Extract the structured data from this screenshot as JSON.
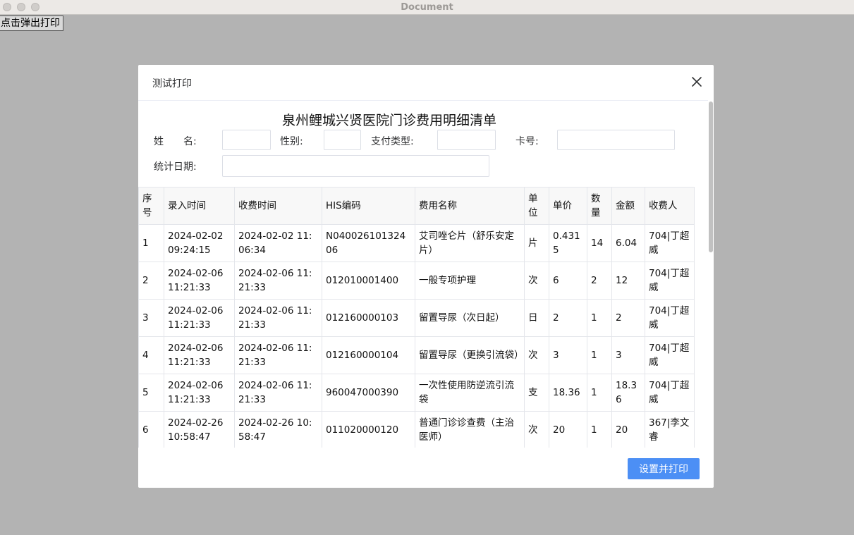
{
  "window": {
    "title": "Document"
  },
  "page": {
    "open_button": "点击弹出打印"
  },
  "dialog": {
    "title": "测试打印",
    "doc_title": "泉州鲤城兴贤医院门诊费用明细清单",
    "labels": {
      "name": "姓　　名:",
      "gender": "性别:",
      "pay_type": "支付类型:",
      "card_no": "卡号:",
      "stat_date": "统计日期:"
    },
    "fields": {
      "name": "",
      "gender": "",
      "pay_type": "",
      "card_no": "",
      "stat_date": ""
    },
    "table": {
      "headers": [
        "序号",
        "录入时间",
        "收费时间",
        "HIS编码",
        "费用名称",
        "单位",
        "单价",
        "数量",
        "金额",
        "收费人"
      ],
      "rows": [
        [
          "1",
          "2024-02-02 09:24:15",
          "2024-02-02 11:06:34",
          "N04002610132406",
          "艾司唑仑片（舒乐安定片）",
          "片",
          "0.4315",
          "14",
          "6.04",
          "704|丁超威"
        ],
        [
          "2",
          "2024-02-06 11:21:33",
          "2024-02-06 11:21:33",
          "012010001400",
          "一般专项护理",
          "次",
          "6",
          "2",
          "12",
          "704|丁超威"
        ],
        [
          "3",
          "2024-02-06 11:21:33",
          "2024-02-06 11:21:33",
          "012160000103",
          "留置导尿（次日起）",
          "日",
          "2",
          "1",
          "2",
          "704|丁超威"
        ],
        [
          "4",
          "2024-02-06 11:21:33",
          "2024-02-06 11:21:33",
          "012160000104",
          "留置导尿（更换引流袋）",
          "次",
          "3",
          "1",
          "3",
          "704|丁超威"
        ],
        [
          "5",
          "2024-02-06 11:21:33",
          "2024-02-06 11:21:33",
          "960047000390",
          "一次性使用防逆流引流袋",
          "支",
          "18.36",
          "1",
          "18.36",
          "704|丁超威"
        ],
        [
          "6",
          "2024-02-26 10:58:47",
          "2024-02-26 10:58:47",
          "011020000120",
          "普通门诊诊查费（主治医师）",
          "次",
          "20",
          "1",
          "20",
          "367|李文睿"
        ]
      ]
    },
    "print_button": "设置并打印"
  }
}
